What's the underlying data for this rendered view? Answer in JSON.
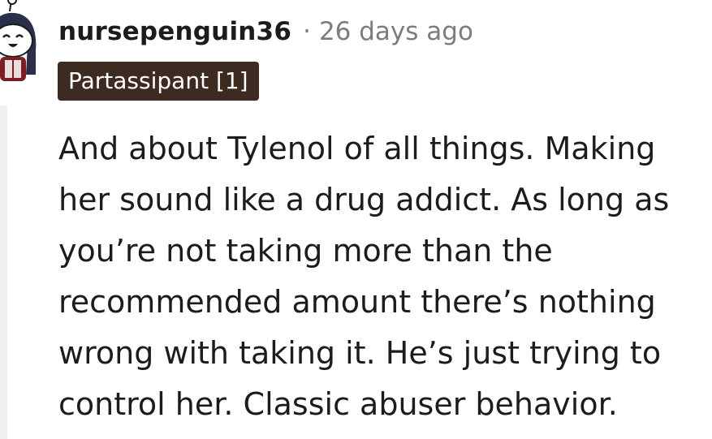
{
  "comment": {
    "author": "nursepenguin36",
    "separator": "·",
    "time_ago": "26 days ago",
    "flair": "Partassipant [1]",
    "body_lines": [
      "And about Tylenol of all things. Making",
      "her sound like a drug addict. As long as",
      "you’re not taking more than the",
      "recommended amount there’s nothing",
      "wrong with taking it. He’s just trying to",
      "control her. Classic abuser behavior."
    ]
  },
  "colors": {
    "author_text": "#1c1c1c",
    "meta_text": "#7c7c7c",
    "flair_background": "#3d2a20",
    "flair_text": "#ffffff",
    "thread_line": "#edeff1"
  },
  "icons": {
    "avatar": "snoo-avatar-icon"
  }
}
